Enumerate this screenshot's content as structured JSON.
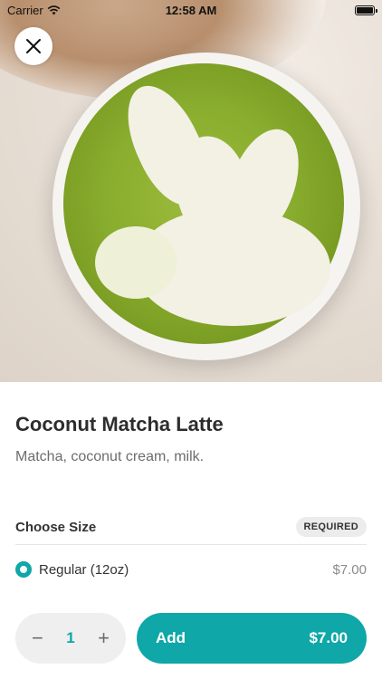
{
  "status_bar": {
    "carrier": "Carrier",
    "time": "12:58 AM",
    "battery_level": 1.0
  },
  "hero": {
    "image_subject": "matcha-latte-photo"
  },
  "product": {
    "title": "Coconut Matcha Latte",
    "description": "Matcha, coconut cream, milk."
  },
  "size_section": {
    "title": "Choose Size",
    "badge": "REQUIRED",
    "options": [
      {
        "label": "Regular (12oz)",
        "price": "$7.00",
        "selected": true
      }
    ]
  },
  "footer": {
    "quantity": "1",
    "minus": "−",
    "plus": "+",
    "add_label": "Add",
    "add_price": "$7.00"
  },
  "colors": {
    "accent": "#0fa7a7"
  }
}
